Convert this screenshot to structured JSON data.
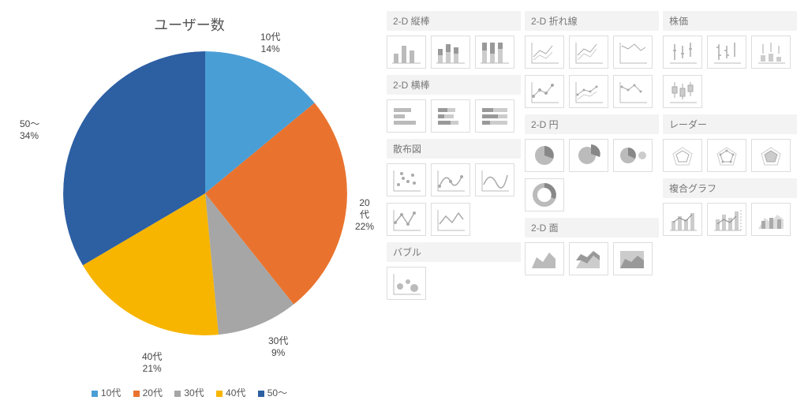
{
  "chart_data": {
    "type": "pie",
    "title": "ユーザー数",
    "categories": [
      "10代",
      "20代",
      "30代",
      "40代",
      "50～"
    ],
    "values": [
      14,
      22,
      9,
      21,
      34
    ],
    "colors": [
      "#4a9ed6",
      "#e9732e",
      "#a6a6a6",
      "#f7b500",
      "#2d5fa3"
    ],
    "slice_labels": [
      {
        "name": "10代",
        "pct": "14%"
      },
      {
        "name": "20代",
        "pct": "22%"
      },
      {
        "name": "30代",
        "pct": "9%"
      },
      {
        "name": "40代",
        "pct": "21%"
      },
      {
        "name": "50～",
        "pct": "34%"
      }
    ],
    "legend": [
      "10代",
      "20代",
      "30代",
      "40代",
      "50～"
    ]
  },
  "picker": {
    "sections": {
      "bar2d": "2-D 縦棒",
      "hbar2d": "2-D 横棒",
      "scatter": "散布図",
      "bubble": "バブル",
      "line2d": "2-D 折れ線",
      "pie2d": "2-D 円",
      "area2d": "2-D 面",
      "stock": "株価",
      "radar": "レーダー",
      "combo": "複合グラフ"
    }
  }
}
